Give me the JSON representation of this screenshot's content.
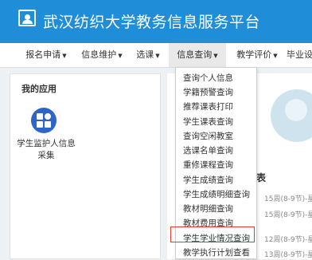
{
  "app": {
    "title": "武汉纺织大学教务信息服务平台"
  },
  "nav": {
    "items": [
      "报名申请",
      "信息维护",
      "选课",
      "信息查询",
      "教学评价",
      "毕业设"
    ]
  },
  "my_apps": {
    "title": "我的应用",
    "items": [
      {
        "label": "学生监护人信息采集"
      }
    ]
  },
  "dropdown": {
    "items": [
      "查询个人信息",
      "学籍预警查询",
      "推荐课表打印",
      "学生课表查询",
      "查询空闲教室",
      "选课名单查询",
      "重修课程查询",
      "学生成绩查询",
      "学生成绩明细查询",
      "教材明细查询",
      "教材费用查询",
      "学生学业情况查询",
      "教学执行计划查看"
    ],
    "highlighted_index": 11
  },
  "right_panel": {
    "table_title": "表",
    "schedules": [
      "15周(8-9节)-星",
      "15周(8-9节)-星",
      "12周(8-9节)-星",
      "13周(8-9节)-星"
    ]
  },
  "colors": {
    "header": "#1f8dd8",
    "app_icon": "#2d66c5",
    "highlight": "#e53935"
  }
}
